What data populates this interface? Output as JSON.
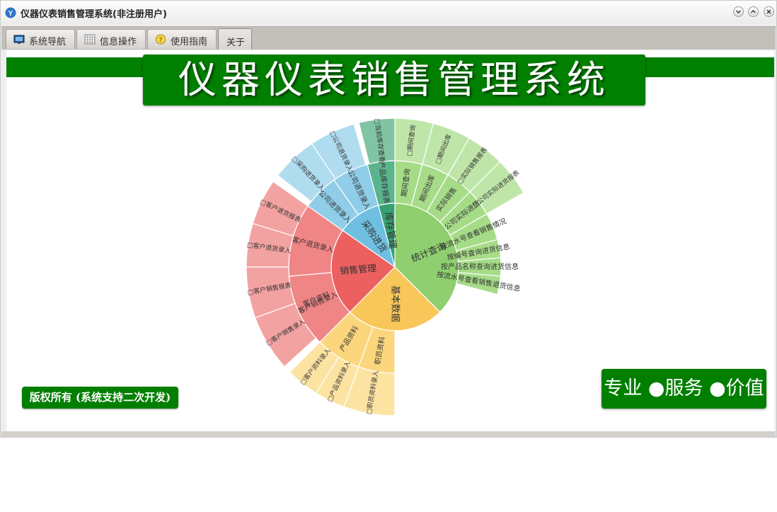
{
  "window": {
    "title": "仪器仪表销售管理系统(非注册用户)",
    "buttons": [
      "minimize-icon",
      "maximize-icon",
      "close-icon"
    ]
  },
  "tabs": [
    {
      "label": "系统导航",
      "icon": "monitor-icon"
    },
    {
      "label": "信息操作",
      "icon": "grid-icon"
    },
    {
      "label": "使用指南",
      "icon": "lightbulb-icon"
    },
    {
      "label": "关于",
      "icon": "",
      "active": true
    }
  ],
  "banner": {
    "title": "仪器仪表销售管理系统"
  },
  "footer": {
    "copyright": "版权所有 (系统支持二次开发)",
    "slogan": "专业 ●服务 ●价值"
  },
  "colors": {
    "brand_green": "#007f00",
    "stats": "#8fcf6f",
    "basic": "#f9c65a",
    "sales": "#ec6060",
    "purchase": "#6fbfe0",
    "stock": "#36a072"
  },
  "sunburst": {
    "categories": [
      {
        "name": "统计查询",
        "children": [
          "期间查询",
          "期间出库",
          "实际销售",
          "公司实际进货",
          "按流水号查看销售情况",
          "按编号查询进货信息",
          "按产品名称查询进货信息",
          "按流水号查看销售退货信息"
        ],
        "leaves": [
          "□期间查询",
          "□期间出库",
          "□实际销售报表",
          "□公司实际进货报表"
        ]
      },
      {
        "name": "基本数据",
        "children": [
          "职员资料",
          "产品资料",
          "客户资料"
        ],
        "leaves": [
          "□职员资料录入",
          "□产品资料录入",
          "□客户资料录入"
        ]
      },
      {
        "name": "销售管理",
        "children": [
          "客户销售录入",
          "客户退货录入"
        ],
        "leaves": [
          "□客户销售录入",
          "□客户销售报表",
          "□客户退货录入",
          "□客户退货报表"
        ]
      },
      {
        "name": "采购进货",
        "children": [
          "公司进货录入",
          "公司退货录入"
        ],
        "leaves": [
          "□采购进货录入",
          "□公司退货录入"
        ]
      },
      {
        "name": "库存管理",
        "children": [
          "产品库存报表"
        ],
        "leaves": [
          "□当前库存查看"
        ]
      }
    ]
  }
}
